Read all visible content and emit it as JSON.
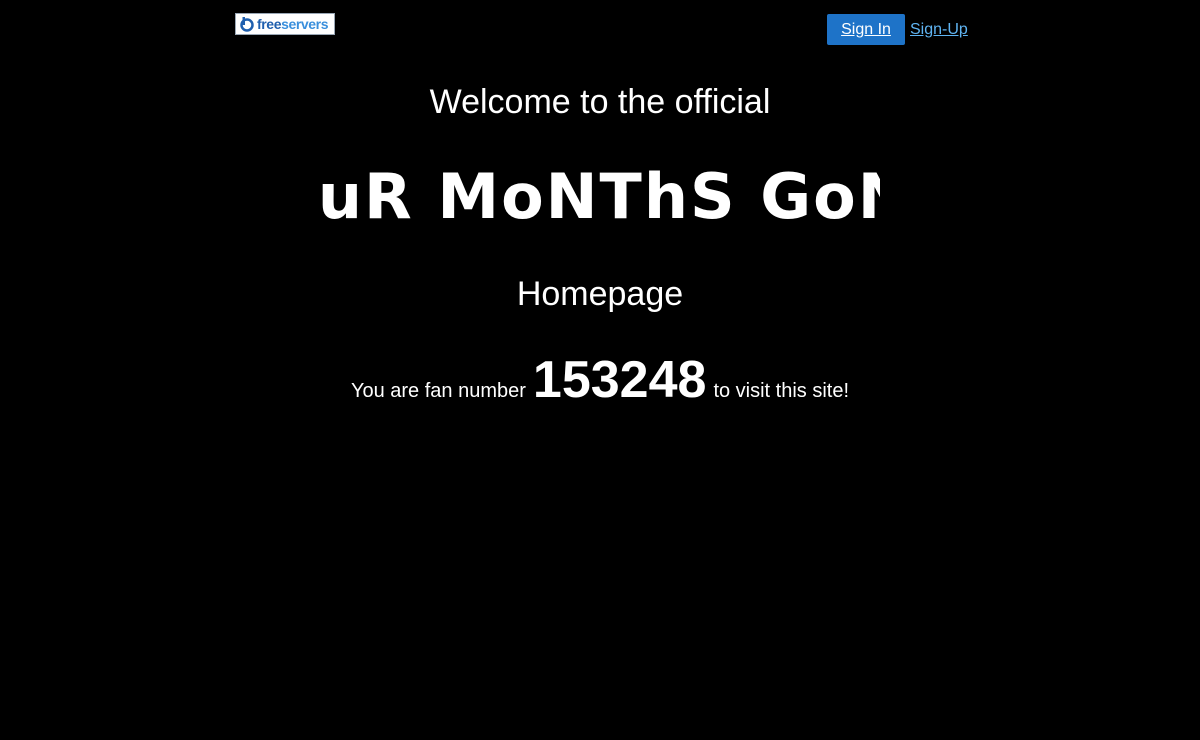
{
  "header": {
    "logo": {
      "icon": "freeservers-logo-icon",
      "text_free": "free",
      "text_servers": "servers"
    },
    "signin_label": "Sign In",
    "signup_label": "Sign-Up"
  },
  "main": {
    "welcome_text": "Welcome to the official",
    "band_name": "fouR MoNThS GoNe",
    "homepage_text": "Homepage",
    "fan_prefix": "You are fan number",
    "fan_count": "153248",
    "fan_suffix": "to visit this site!"
  },
  "colors": {
    "background": "#000000",
    "text": "#ffffff",
    "signin_button": "#1e73c8",
    "signup_link": "#5fb4f2",
    "logo_free": "#1f5fae",
    "logo_servers": "#3a8fdc"
  }
}
